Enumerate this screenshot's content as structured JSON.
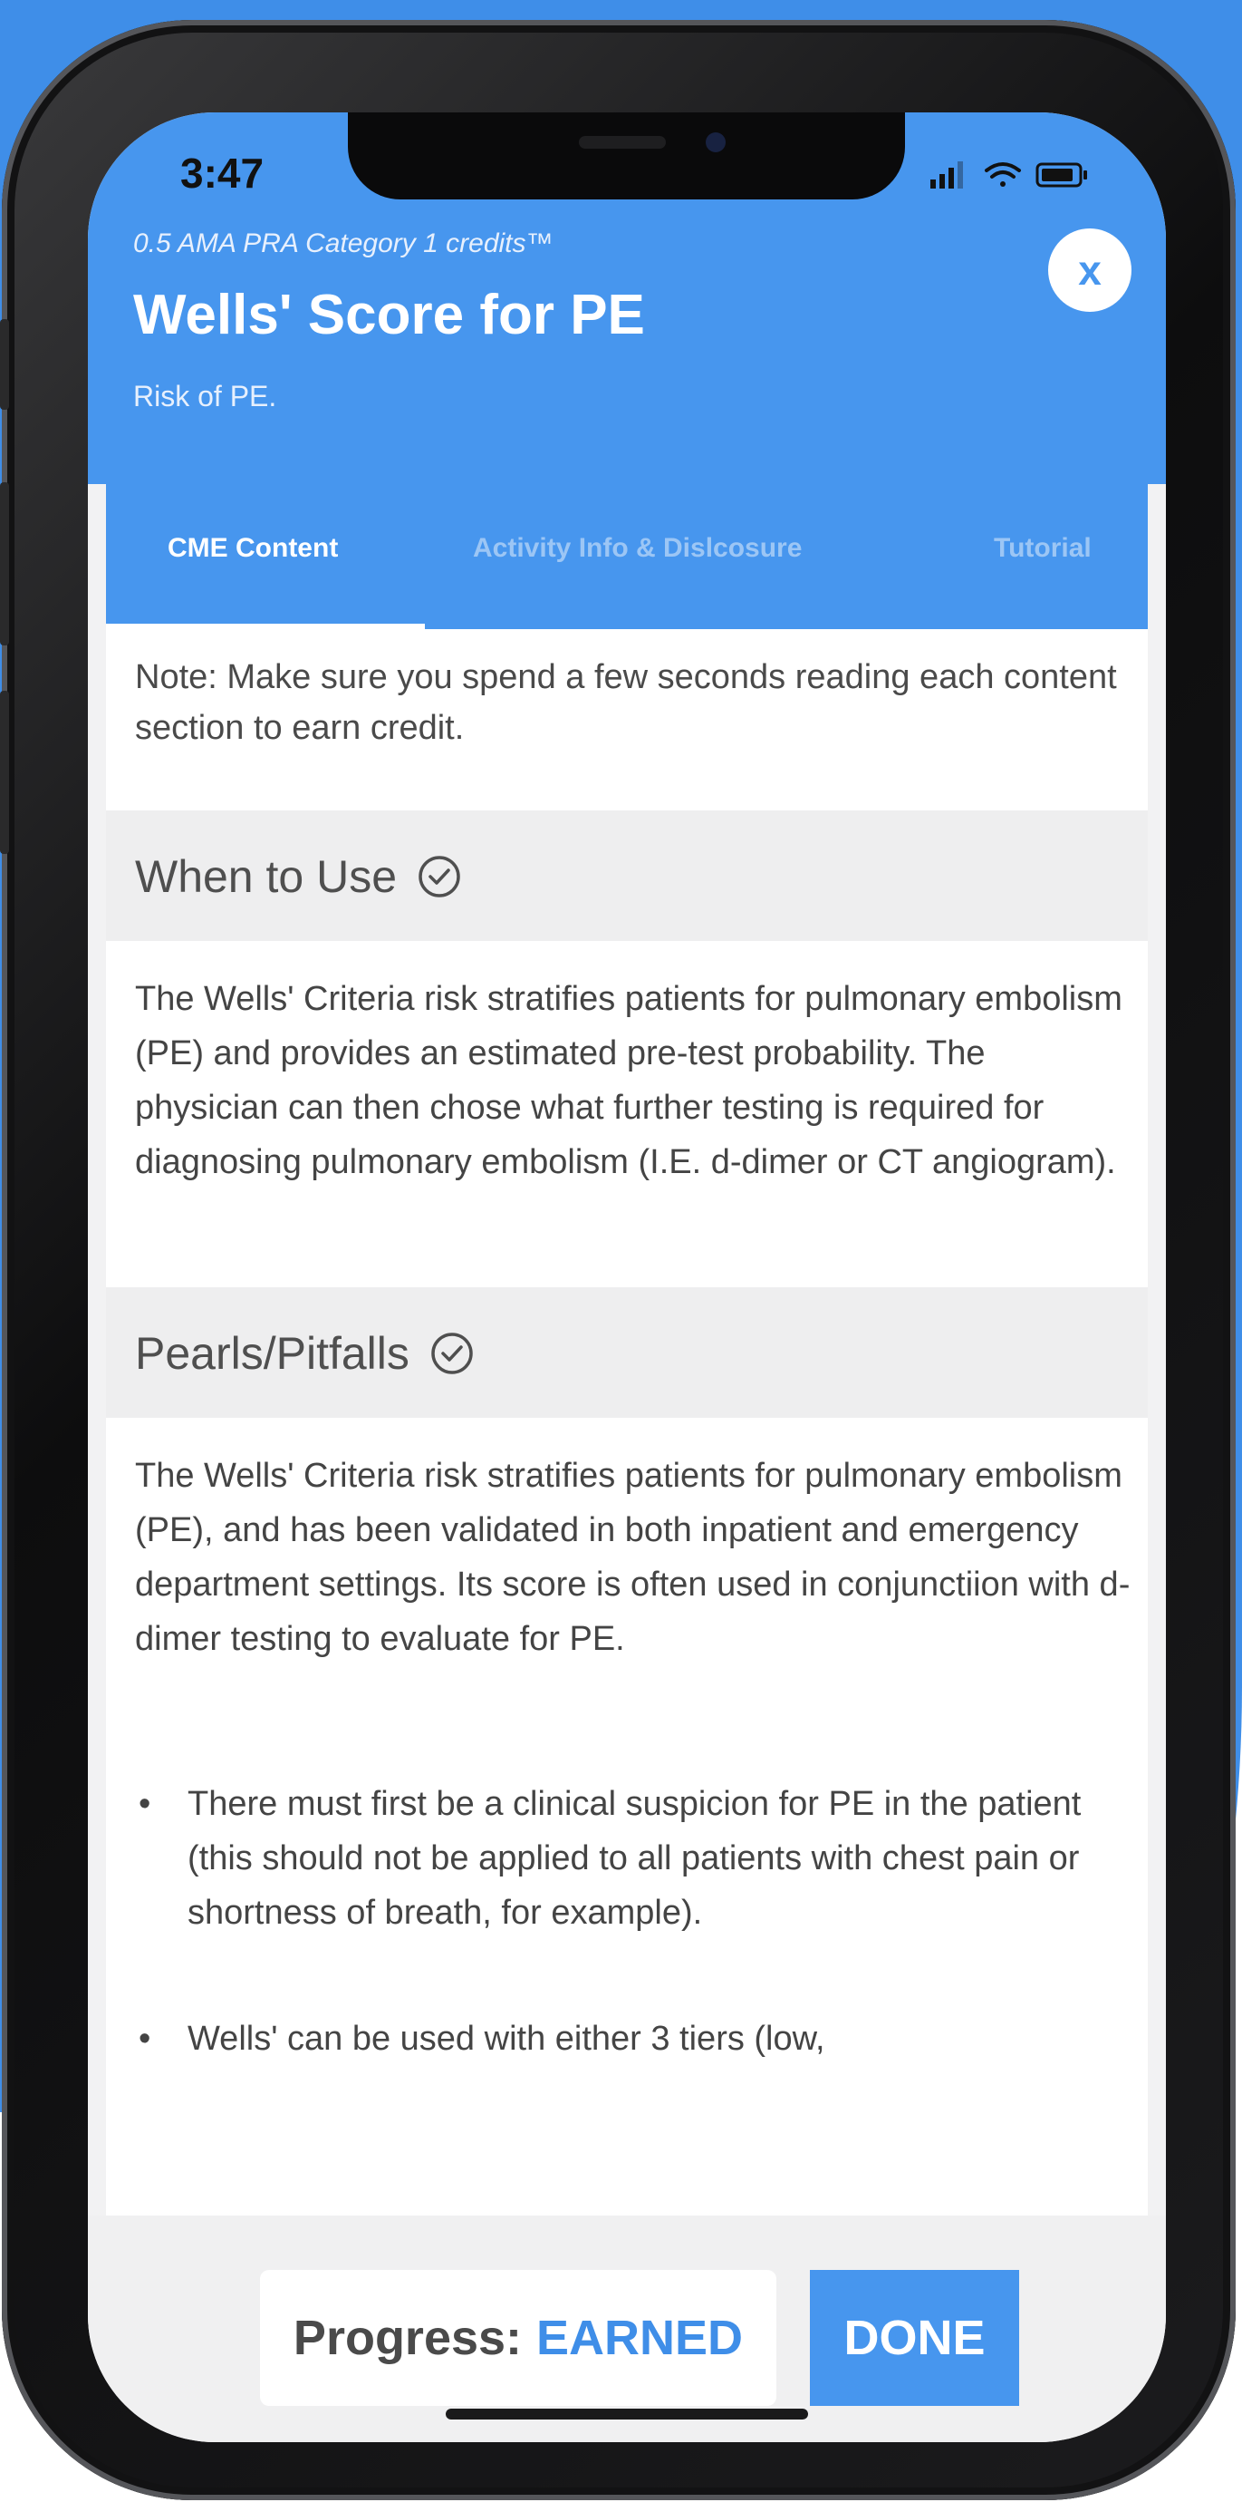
{
  "status_bar": {
    "time": "3:47"
  },
  "header": {
    "credits": "0.5 AMA PRA Category 1 credits™",
    "title": "Wells' Score for PE",
    "subtitle": "Risk of PE.",
    "close_label": "x"
  },
  "tabs": [
    {
      "label": "CME Content",
      "active": true
    },
    {
      "label": "Activity Info & Dislcosure",
      "active": false
    },
    {
      "label": "Tutorial",
      "active": false
    }
  ],
  "note": "Note: Make sure you spend a few seconds reading each content section to earn credit.",
  "sections": [
    {
      "heading": "When to Use",
      "body": "The Wells' Criteria risk stratifies patients for pulmonary embolism (PE) and provides an estimated pre-test probability. The physician can then chose what further testing is required for diagnosing pulmonary embolism (I.E. d-dimer or CT angiogram)."
    },
    {
      "heading": "Pearls/Pitfalls",
      "body": "The Wells' Criteria risk stratifies patients for pulmonary embolism (PE), and has been validated in both inpatient and emergency department settings. Its score is often used in conjunctiion with d-dimer testing to evaluate for PE.",
      "bullets": [
        "There must first be a clinical suspicion for PE in the patient (this should not be applied to all patients with chest pain or shortness of breath, for example).",
        "Wells' can be used with either 3 tiers (low,"
      ]
    }
  ],
  "footer": {
    "progress_label": "Progress:",
    "progress_status": "EARNED",
    "done_label": "DONE"
  },
  "colors": {
    "accent": "#4796ee",
    "background": "#3f8ee8"
  }
}
